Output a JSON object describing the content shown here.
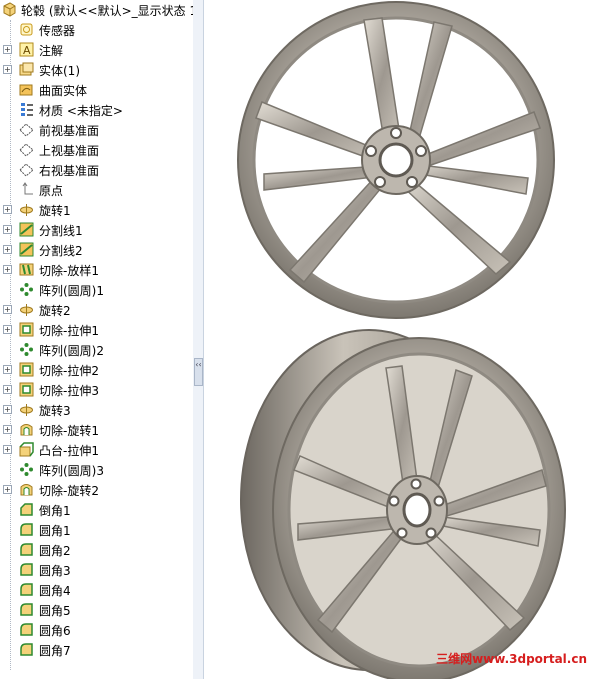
{
  "tree": {
    "root_label": "轮毂 (默认<<默认>_显示状态 1",
    "items": [
      {
        "label": "传感器",
        "icon": "sensor-icon",
        "expandable": false
      },
      {
        "label": "注解",
        "icon": "annotation-icon",
        "expandable": true
      },
      {
        "label": "实体(1)",
        "icon": "solid-bodies-icon",
        "expandable": true
      },
      {
        "label": "曲面实体",
        "icon": "surface-bodies-icon",
        "expandable": false
      },
      {
        "label": "材质 <未指定>",
        "icon": "material-icon",
        "expandable": false
      },
      {
        "label": "前视基准面",
        "icon": "plane-icon",
        "expandable": false
      },
      {
        "label": "上视基准面",
        "icon": "plane-icon",
        "expandable": false
      },
      {
        "label": "右视基准面",
        "icon": "plane-icon",
        "expandable": false
      },
      {
        "label": "原点",
        "icon": "origin-icon",
        "expandable": false
      },
      {
        "label": "旋转1",
        "icon": "revolve-icon",
        "expandable": true
      },
      {
        "label": "分割线1",
        "icon": "split-line-icon",
        "expandable": true
      },
      {
        "label": "分割线2",
        "icon": "split-line-icon",
        "expandable": true
      },
      {
        "label": "切除-放样1",
        "icon": "cut-loft-icon",
        "expandable": true
      },
      {
        "label": "阵列(圆周)1",
        "icon": "circular-pattern-icon",
        "expandable": false
      },
      {
        "label": "旋转2",
        "icon": "revolve-icon",
        "expandable": true
      },
      {
        "label": "切除-拉伸1",
        "icon": "cut-extrude-icon",
        "expandable": true
      },
      {
        "label": "阵列(圆周)2",
        "icon": "circular-pattern-icon",
        "expandable": false
      },
      {
        "label": "切除-拉伸2",
        "icon": "cut-extrude-icon",
        "expandable": true
      },
      {
        "label": "切除-拉伸3",
        "icon": "cut-extrude-icon",
        "expandable": true
      },
      {
        "label": "旋转3",
        "icon": "revolve-icon",
        "expandable": true
      },
      {
        "label": "切除-旋转1",
        "icon": "cut-revolve-icon",
        "expandable": true
      },
      {
        "label": "凸台-拉伸1",
        "icon": "boss-extrude-icon",
        "expandable": true
      },
      {
        "label": "阵列(圆周)3",
        "icon": "circular-pattern-icon",
        "expandable": false
      },
      {
        "label": "切除-旋转2",
        "icon": "cut-revolve-icon",
        "expandable": true
      },
      {
        "label": "倒角1",
        "icon": "chamfer-icon",
        "expandable": false
      },
      {
        "label": "圆角1",
        "icon": "fillet-icon",
        "expandable": false
      },
      {
        "label": "圆角2",
        "icon": "fillet-icon",
        "expandable": false
      },
      {
        "label": "圆角3",
        "icon": "fillet-icon",
        "expandable": false
      },
      {
        "label": "圆角4",
        "icon": "fillet-icon",
        "expandable": false
      },
      {
        "label": "圆角5",
        "icon": "fillet-icon",
        "expandable": false
      },
      {
        "label": "圆角6",
        "icon": "fillet-icon",
        "expandable": false
      },
      {
        "label": "圆角7",
        "icon": "fillet-icon",
        "expandable": false
      }
    ]
  },
  "watermark": "三维网www.3dportal.cn"
}
